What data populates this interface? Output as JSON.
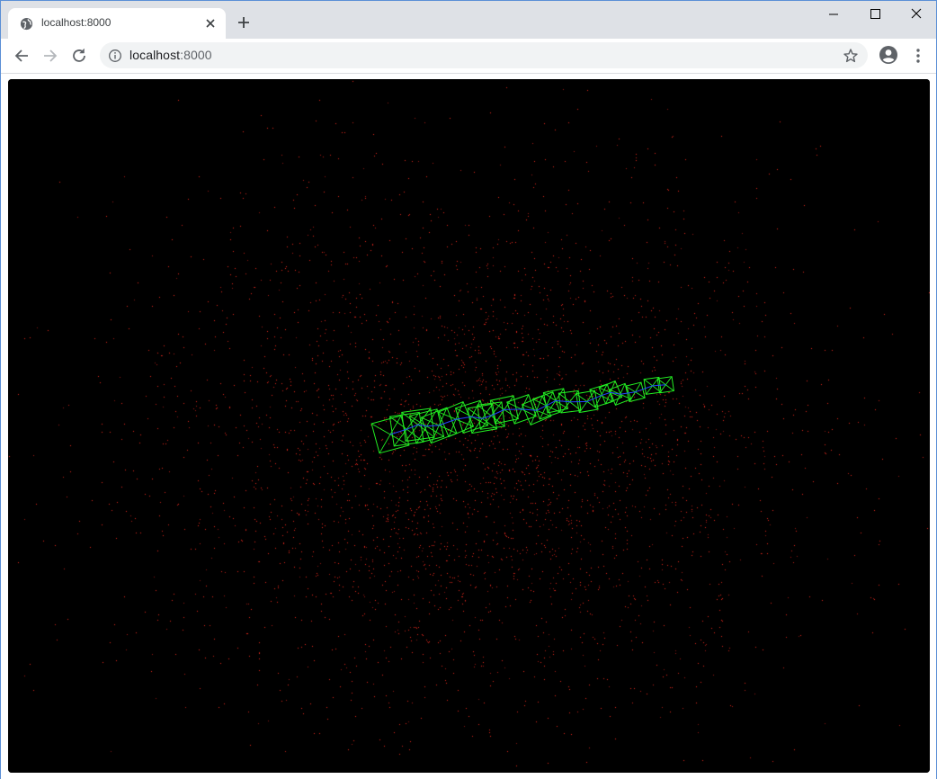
{
  "browser": {
    "tab": {
      "title": "localhost:8000"
    },
    "address_bar": {
      "host": "localhost",
      "port": ":8000"
    }
  },
  "scene": {
    "background_color": "#000000",
    "point_color": "#e8281e",
    "frustum_color": "#22ee22",
    "path_color": "#2244ff"
  },
  "icons": {
    "favicon": "globe-icon",
    "close": "close-icon",
    "new_tab": "plus-icon",
    "back": "arrow-left-icon",
    "forward": "arrow-right-icon",
    "reload": "reload-icon",
    "info": "info-icon",
    "bookmark": "star-icon",
    "profile": "account-icon",
    "menu": "kebab-menu-icon",
    "minimize": "minimize-icon",
    "maximize": "maximize-icon",
    "close_window": "close-window-icon"
  }
}
